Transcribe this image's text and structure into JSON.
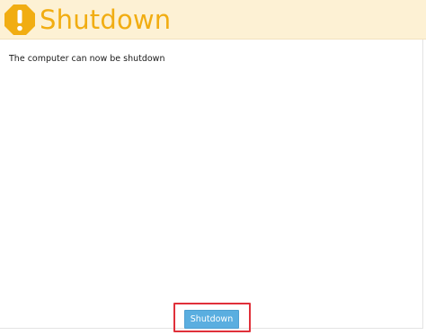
{
  "header": {
    "title": "Shutdown",
    "icon": "warning-icon",
    "icon_color": "#f1ad12",
    "background": "#fdf1d4"
  },
  "main": {
    "message": "The computer can now be shutdown"
  },
  "footer": {
    "shutdown_label": "Shutdown",
    "button_color": "#5aaee0",
    "highlight_color": "#e0303a"
  }
}
